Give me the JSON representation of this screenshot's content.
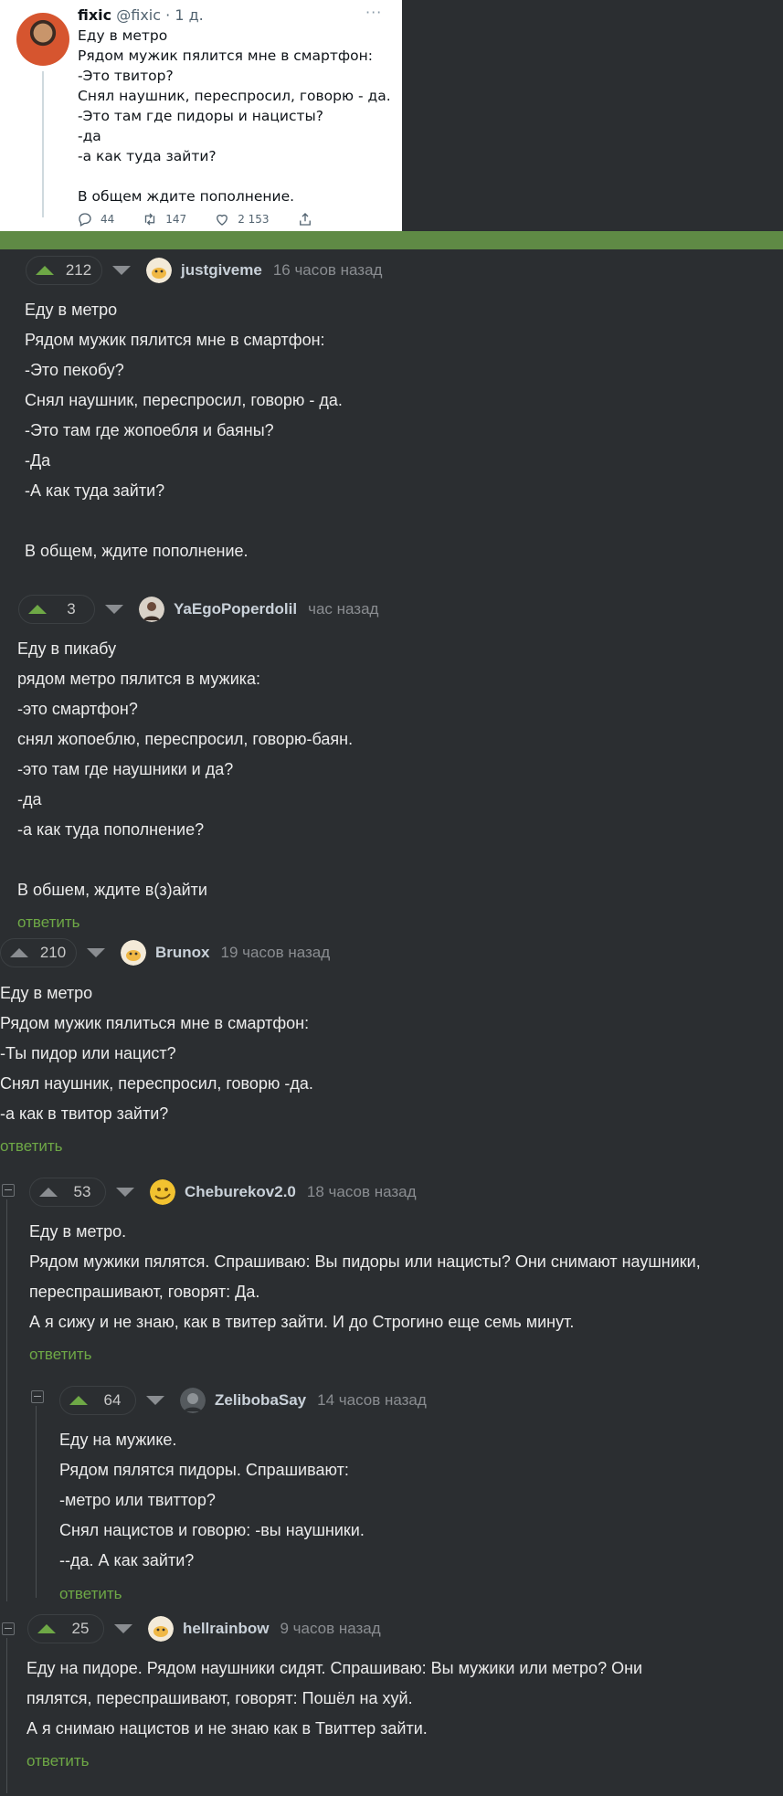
{
  "tweet": {
    "name": "fixic",
    "handle": "@fixic",
    "time": "· 1 д.",
    "more": "···",
    "lines": [
      "Еду в метро",
      "Рядом мужик пялится мне в смартфон:",
      "-Это твитор?",
      "Снял наушник, переспросил, говорю - да.",
      "-Это там где пидоры и нацисты?",
      "-да",
      "-а как туда зайти?",
      "",
      "В общем ждите пополнение."
    ],
    "replies": "44",
    "retweets": "147",
    "likes": "2 153",
    "icons": [
      "reply-icon",
      "retweet-icon",
      "like-icon",
      "share-icon"
    ]
  },
  "colors": {
    "accent_green": "#6ea846",
    "banner": "#5f8a45",
    "background": "#2b2e31"
  },
  "comments": [
    {
      "score": "212",
      "user": "justgiveme",
      "time": "16 часов назад",
      "lines": [
        "Еду в метро",
        "Рядом мужик пялится мне в смартфон:",
        "-Это пекобу?",
        "Снял наушник, переспросил, говорю - да.",
        "-Это там где жопоебля и баяны?",
        "-Да",
        "-А как туда зайти?",
        "",
        "В общем, ждите пополнение."
      ]
    },
    {
      "score": "3",
      "user": "YaEgoPoperdolil",
      "time": "час назад",
      "lines": [
        "Еду в пикабу",
        "рядом метро пялится в мужика:",
        "-это смартфон?",
        "снял жопоеблю, переспросил, говорю-баян.",
        "-это там где наушники и да?",
        "-да",
        "-а как туда пополнение?",
        "",
        "В обшем, ждите в(з)айти"
      ],
      "reply": "ответить"
    },
    {
      "score": "210",
      "user": "Brunox",
      "time": "19 часов назад",
      "lines": [
        "Еду в метро",
        "Рядом мужик пялиться мне в смартфон:",
        "-Ты пидор или нацист?",
        "Снял наушник, переспросил, говорю -да.",
        "-а как в твитор зайти?"
      ],
      "reply": "ответить"
    },
    {
      "score": "53",
      "user": "Cheburekov2.0",
      "time": "18 часов назад",
      "lines": [
        "Еду в метро.",
        "Рядом мужики пялятся. Спрашиваю: Вы пидоры или нацисты? Они снимают наушники,",
        "переспрашивают, говорят: Да.",
        "А я сижу и не знаю, как в твитер зайти. И до Строгино еще семь минут."
      ],
      "reply": "ответить"
    },
    {
      "score": "64",
      "user": "ZelibobaSay",
      "time": "14 часов назад",
      "lines": [
        "Еду на мужике.",
        "Рядом пялятся пидоры. Спрашивают:",
        "-метро или твиттор?",
        "Снял нацистов и говорю: -вы наушники.",
        "--да. А как зайти?"
      ],
      "reply": "ответить"
    },
    {
      "score": "25",
      "user": "hellrainbow",
      "time": "9 часов назад",
      "lines": [
        "Еду на пидоре. Рядом наушники сидят. Спрашиваю: Вы мужики или метро? Они",
        "пялятся, переспрашивают, говорят: Пошёл на хуй.",
        "А я снимаю нацистов и не знаю как в Твиттер зайти."
      ],
      "reply": "ответить"
    }
  ]
}
